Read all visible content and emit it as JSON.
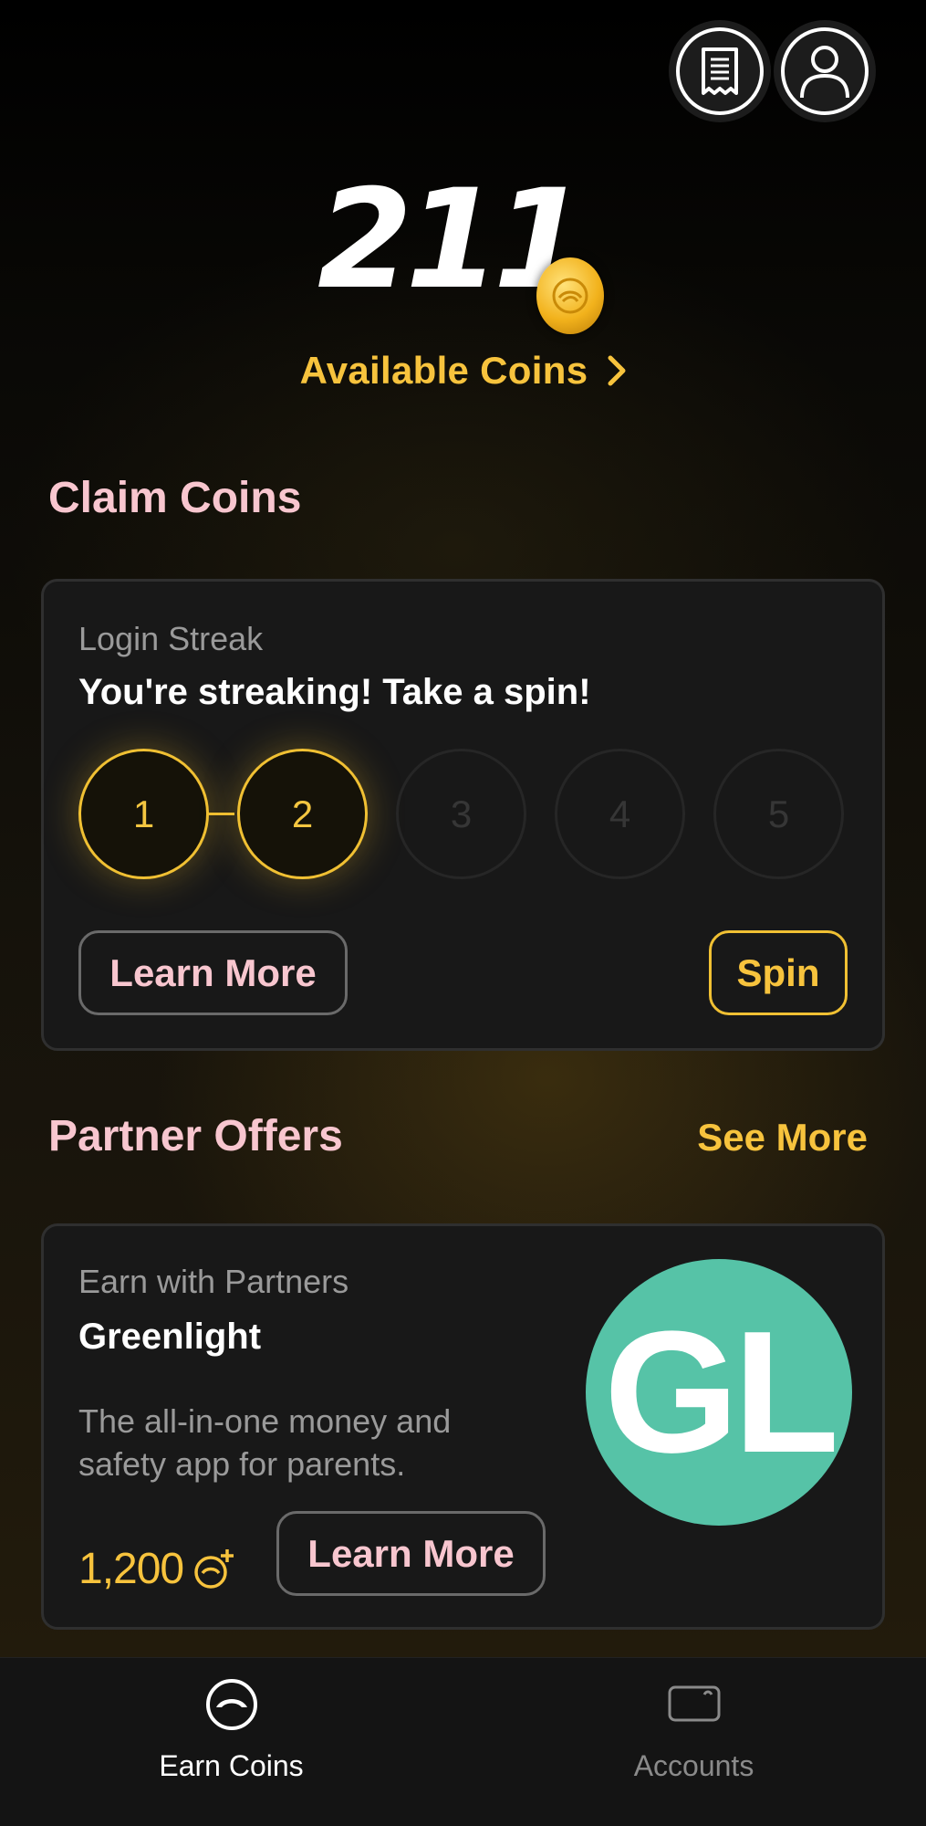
{
  "header": {
    "receipt_icon": "receipt-icon",
    "profile_icon": "profile-icon"
  },
  "balance": {
    "value": "211",
    "coin_icon": "coin-icon",
    "label": "Available Coins"
  },
  "claim": {
    "title": "Claim Coins",
    "card": {
      "subtitle": "Login Streak",
      "headline": "You're streaking! Take a spin!",
      "days": [
        "1",
        "2",
        "3",
        "4",
        "5"
      ],
      "completed_days": 2,
      "learn_more": "Learn More",
      "spin": "Spin"
    }
  },
  "partners": {
    "title": "Partner Offers",
    "see_more": "See More",
    "card": {
      "subtitle": "Earn with Partners",
      "name": "Greenlight",
      "description": "The all-in-one money and safety app for parents.",
      "logo_text": "GL",
      "reward": "1,200",
      "learn_more": "Learn More"
    }
  },
  "tabs": [
    {
      "label": "Earn Coins",
      "icon": "earn-coins-icon",
      "active": true
    },
    {
      "label": "Accounts",
      "icon": "wallet-icon",
      "active": false
    }
  ],
  "colors": {
    "gold": "#f7c33d",
    "pink": "#f8c6cf",
    "greenlight": "#56c3a7"
  }
}
